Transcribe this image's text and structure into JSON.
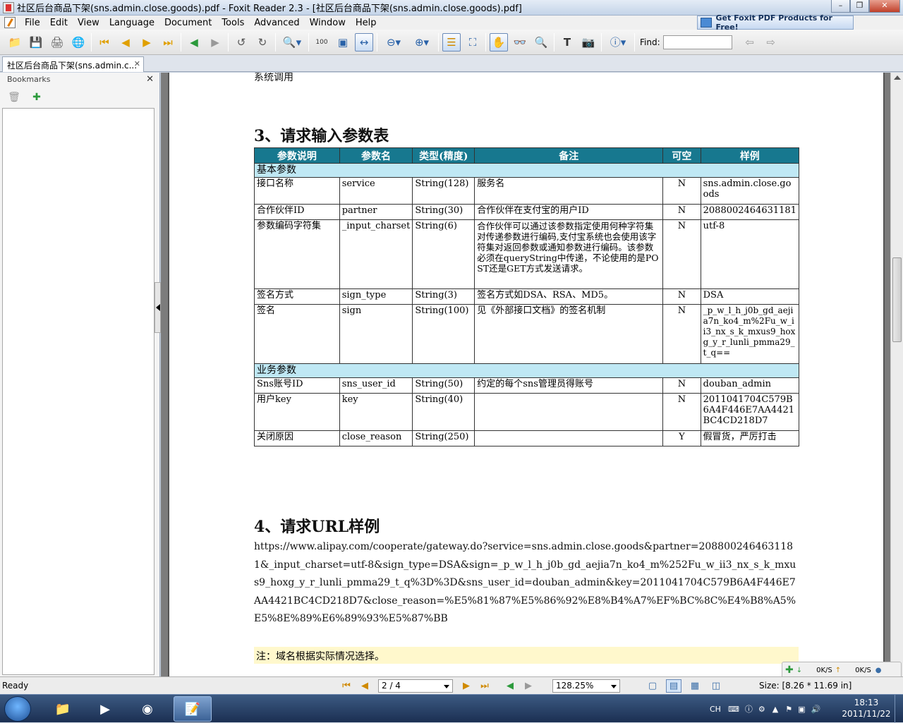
{
  "window": {
    "title": "社区后台商品下架(sns.admin.close.goods).pdf - Foxit Reader 2.3 - [社区后台商品下架(sns.admin.close.goods).pdf]",
    "promo": "Get Foxit PDF Products for Free!"
  },
  "menu": [
    "File",
    "Edit",
    "View",
    "Language",
    "Document",
    "Tools",
    "Advanced",
    "Window",
    "Help"
  ],
  "toolbar": {
    "find_label": "Find:",
    "find_value": ""
  },
  "tab": {
    "label": "社区后台商品下架(sns.admin.c..."
  },
  "bookmarks": {
    "title": "Bookmarks"
  },
  "page": {
    "top_text": "系统调用",
    "section3": "3、请求输入参数表",
    "table": {
      "headers": [
        "参数说明",
        "参数名",
        "类型(精度)",
        "备注",
        "可空",
        "样例"
      ],
      "section_basic": "基本参数",
      "section_business": "业务参数",
      "rows": [
        [
          "接口名称",
          "service",
          "String(128)",
          "服务名",
          "N",
          "sns.admin.close.goods"
        ],
        [
          "合作伙伴ID",
          "partner",
          "String(30)",
          "合作伙伴在支付宝的用户ID",
          "N",
          "2088002464631181"
        ],
        [
          "参数编码字符集",
          "_input_charset",
          "String(6)",
          "合作伙伴可以通过该参数指定使用何种字符集对传递参数进行编码,支付宝系统也会使用该字符集对返回参数或通知参数进行编码。该参数必须在queryString中传递，不论使用的是POST还是GET方式发送请求。",
          "N",
          "utf-8"
        ],
        [
          "签名方式",
          "sign_type",
          "String(3)",
          "签名方式如DSA、RSA、MD5。",
          "N",
          "DSA"
        ],
        [
          "签名",
          "sign",
          "String(100)",
          "见《外部接口文档》的签名机制",
          "N",
          "_p_w_l_h_j0b_gd_aejia7n_ko4_m%2Fu_w_ii3_nx_s_k_mxus9_hoxg_y_r_lunli_pmma29_t_q=="
        ],
        [
          "Sns账号ID",
          "sns_user_id",
          "String(50)",
          "约定的每个sns管理员得账号",
          "N",
          "douban_admin"
        ],
        [
          "用户key",
          "key",
          "String(40)",
          "",
          "N",
          "2011041704C579B6A4F446E7AA4421BC4CD218D7"
        ],
        [
          "关闭原因",
          "close_reason",
          "String(250)",
          "",
          "Y",
          "假冒货，严厉打击"
        ]
      ]
    },
    "section4": "4、请求URL样例",
    "url": "https://www.alipay.com/cooperate/gateway.do?service=sns.admin.close.goods&partner=2088002464631181&_input_charset=utf-8&sign_type=DSA&sign=_p_w_l_h_j0b_gd_aejia7n_ko4_m%252Fu_w_ii3_nx_s_k_mxus9_hoxg_y_r_lunli_pmma29_t_q%3D%3D&sns_user_id=douban_admin&key=2011041704C579B6A4F446E7AA4421BC4CD218D7&close_reason=%E5%81%87%E5%86%92%E8%B4%A7%EF%BC%8C%E4%B8%A5%E5%8E%89%E6%89%93%E5%87%BB",
    "note": "注：域名根据实际情况选择。"
  },
  "status": {
    "ready": "Ready",
    "page": "2 / 4",
    "zoom": "128.25%",
    "size": "Size: [8.26 * 11.69 in]"
  },
  "net": {
    "down": "0K/S",
    "up": "0K/S"
  },
  "tray": {
    "lang": "CH",
    "time": "18:13",
    "date": "2011/11/22"
  }
}
